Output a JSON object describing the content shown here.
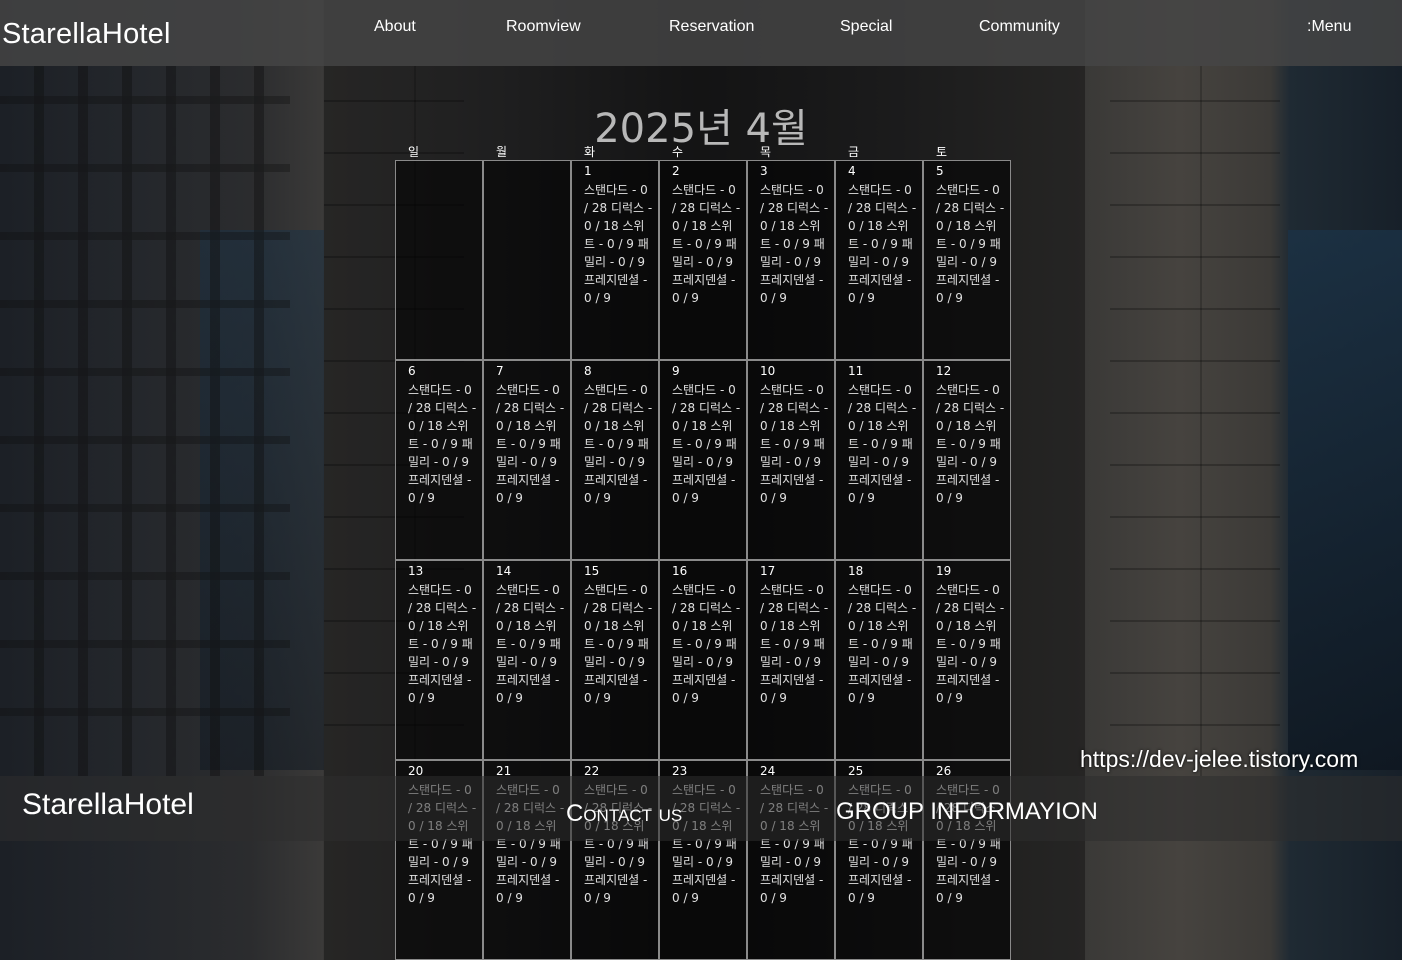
{
  "header": {
    "logo": "StarellaHotel",
    "nav": [
      {
        "label": "About"
      },
      {
        "label": "Roomview"
      },
      {
        "label": "Reservation"
      },
      {
        "label": "Special"
      },
      {
        "label": "Community"
      }
    ],
    "menu_label": ":Menu"
  },
  "calendar": {
    "title": "2025년 4월",
    "weekdays": [
      "일",
      "월",
      "화",
      "수",
      "목",
      "금",
      "토"
    ],
    "rooms_text": "스탠다드 - 0 / 28 디럭스 - 0 / 18 스위트 - 0 / 9 패밀리 - 0 / 9 프레지덴셜 - 0 / 9",
    "days": [
      "",
      "",
      "1",
      "2",
      "3",
      "4",
      "5",
      "6",
      "7",
      "8",
      "9",
      "10",
      "11",
      "12",
      "13",
      "14",
      "15",
      "16",
      "17",
      "18",
      "19",
      "20",
      "21",
      "22",
      "23",
      "24",
      "25",
      "26"
    ]
  },
  "footer": {
    "logo": "StarellaHotel",
    "contact": "Contact us",
    "group": "GROUP INFORMAYION",
    "blog": "https://dev-jelee.tistory.com"
  }
}
